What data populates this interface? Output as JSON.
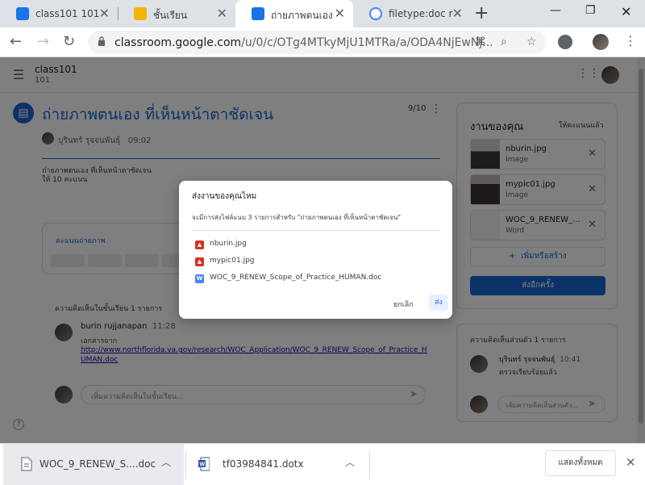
{
  "browser": {
    "tabs": [
      {
        "title": "class101 101",
        "favicon": "classroom-icon",
        "color": "#1a73e8"
      },
      {
        "title": "ชั้นเรียน",
        "favicon": "classroom-yellow-icon",
        "color": "#f4b400"
      },
      {
        "title": "ถ่ายภาพตนเอง ที่",
        "favicon": "classroom-icon",
        "color": "#1a73e8"
      },
      {
        "title": "filetype:doc re",
        "favicon": "google-icon",
        "color": "#4285f4"
      }
    ],
    "url_host": "classroom.google.com",
    "url_path": "/u/0/c/OTg4MTkyMjU1MTRa/a/ODA4NjEwNj..."
  },
  "classroom": {
    "class_name": "class101",
    "class_section": "101",
    "assignment_title": "ถ่ายภาพตนเอง ที่เห็นหน้าตาชัดเจน",
    "author": "บุรินทร์ รุจจนพันธุ์",
    "time": "09:02",
    "points": "9/10",
    "description_line1": "ถ่ายภาพตนเอง ที่เห็นหน้าตาชัดเจน",
    "description_line2": "ให้ 10 คะแนน",
    "rubric_label": "คะแนนถ่ายภาพ",
    "class_comments_title": "ความคิดเห็นในชั้นเรียน 1 รายการ",
    "comment_author": "burin rujjanapan",
    "comment_time": "11:28",
    "comment_text": "เอกสารจาก",
    "comment_link": "http://www.northflorida.va.gov/research/WOC_Application/WOC_9_RENEW_Scope_of_Practice_HUMAN.doc",
    "class_comment_placeholder": "เพิ่มความคิดเห็นในชั้นเรียน..."
  },
  "your_work": {
    "title": "งานของคุณ",
    "status": "ให้คะแนนแล้ว",
    "attachments": [
      {
        "name": "nburin.jpg",
        "type": "Image"
      },
      {
        "name": "mypic01.jpg",
        "type": "Image"
      },
      {
        "name": "WOC_9_RENEW_...",
        "type": "Word"
      }
    ],
    "add_create_label": "เพิ่มหรือสร้าง",
    "resubmit_label": "ส่งอีกครั้ง"
  },
  "private_comments": {
    "title": "ความคิดเห็นส่วนตัว 1 รายการ",
    "author": "บุรินทร์ รุจจนพันธุ์",
    "time": "10:41",
    "text": "ตรวจเรียบร้อยแล้ว",
    "placeholder": "เพิ่มความคิดเห็นส่วนตัว..."
  },
  "dialog": {
    "title": "ส่งงานของคุณไหม",
    "body": "จะมีการส่งไฟล์แนบ 3 รายการสำหรับ \"ถ่ายภาพตนเอง ที่เห็นหน้าตาชัดเจน\"",
    "files": [
      {
        "name": "nburin.jpg",
        "icon": "image-file-icon",
        "color": "#d93025"
      },
      {
        "name": "mypic01.jpg",
        "icon": "image-file-icon",
        "color": "#d93025"
      },
      {
        "name": "WOC_9_RENEW_Scope_of_Practice_HUMAN.doc",
        "icon": "word-file-icon",
        "color": "#4285f4"
      }
    ],
    "cancel_label": "ยกเลิก",
    "submit_label": "ส่ง"
  },
  "downloads": {
    "items": [
      {
        "name": "WOC_9_RENEW_S....doc"
      },
      {
        "name": "tf03984841.dotx"
      }
    ],
    "show_all_label": "แสดงทั้งหมด"
  }
}
